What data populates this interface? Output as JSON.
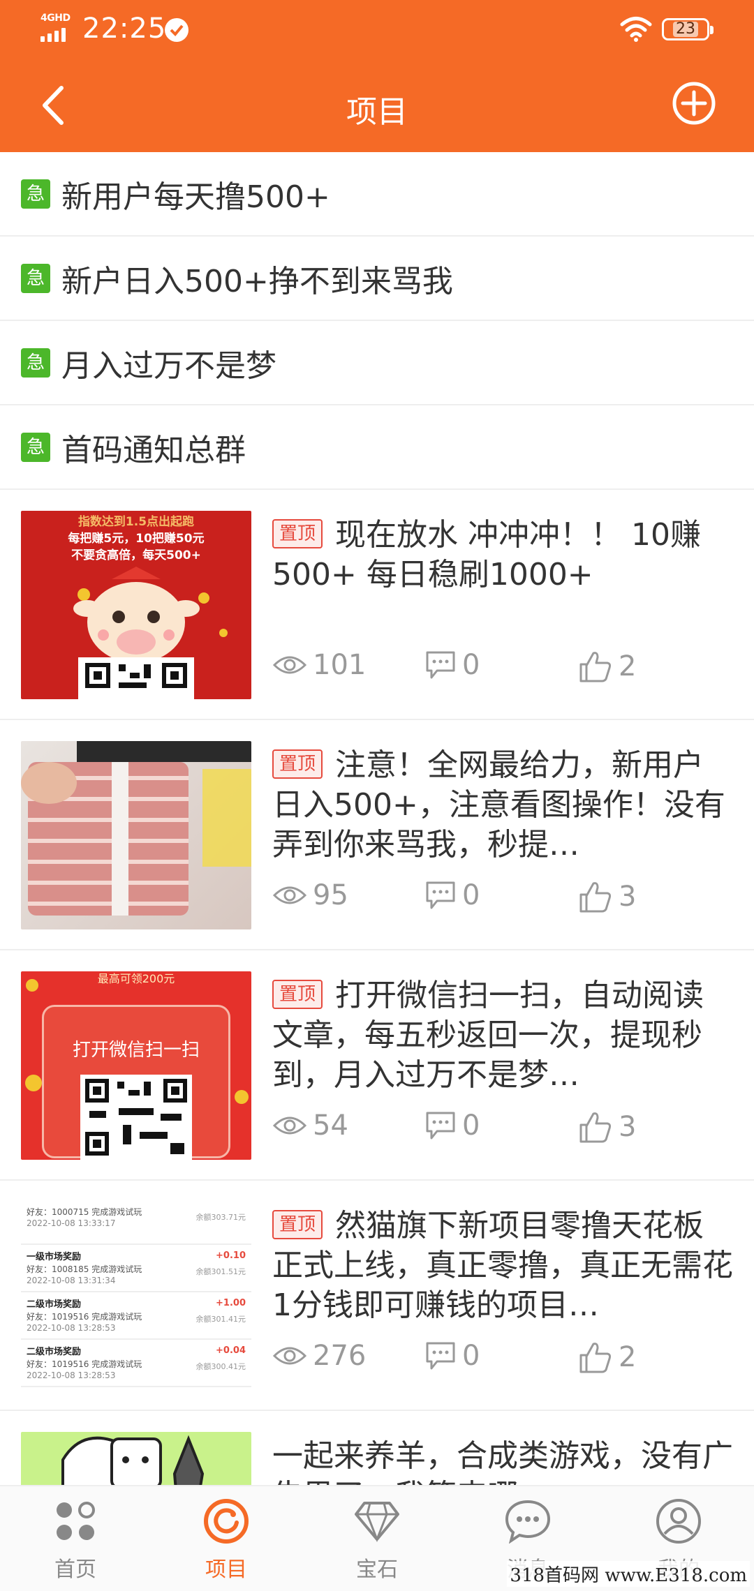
{
  "status_bar": {
    "network": "4GHD",
    "time": "22:25",
    "battery": "23"
  },
  "nav": {
    "title": "项目"
  },
  "notices": [
    {
      "badge": "急",
      "text": "新用户每天撸500+"
    },
    {
      "badge": "急",
      "text": "新户日入500+挣不到来骂我"
    },
    {
      "badge": "急",
      "text": "月入过万不是梦"
    },
    {
      "badge": "急",
      "text": "首码通知总群"
    }
  ],
  "posts": [
    {
      "pin": "置顶",
      "title": "现在放水 冲冲冲！！ 10赚500+ 每日稳刷1000+",
      "views": "101",
      "comments": "0",
      "likes": "2",
      "thumb": {
        "lines": [
          "指数达到1.5点出起跑",
          "每把赚5元，10把赚50元",
          "不要贪高倍，每天500+"
        ]
      }
    },
    {
      "pin": "置顶",
      "title": "注意！全网最给力，新用户日入500+，注意看图操作！没有弄到你来骂我，秒提…",
      "views": "95",
      "comments": "0",
      "likes": "3"
    },
    {
      "pin": "置顶",
      "title": "打开微信扫一扫，自动阅读文章，每五秒返回一次，提现秒到，月入过万不是梦…",
      "views": "54",
      "comments": "0",
      "likes": "3",
      "thumb": {
        "top": "最高可领200元",
        "button": "打开微信扫一扫"
      }
    },
    {
      "pin": "置顶",
      "title": "然猫旗下新项目零撸天花板正式上线，真正零撸，真正无需花1分钱即可赚钱的项目…",
      "views": "276",
      "comments": "0",
      "likes": "2",
      "thumb": {
        "rows": [
          {
            "head": "",
            "friend": "好友：1000715 完成游戏试玩",
            "date": "2022-10-08 13:33:17",
            "amount": "",
            "balance": "余额303.71元"
          },
          {
            "head": "一级市场奖励",
            "friend": "好友：1008185 完成游戏试玩",
            "date": "2022-10-08 13:31:34",
            "amount": "+0.10",
            "balance": "余额301.51元"
          },
          {
            "head": "二级市场奖励",
            "friend": "好友：1019516 完成游戏试玩",
            "date": "2022-10-08 13:28:53",
            "amount": "+1.00",
            "balance": "余额301.41元"
          },
          {
            "head": "二级市场奖励",
            "friend": "好友：1019516 完成游戏试玩",
            "date": "2022-10-08 13:28:53",
            "amount": "+0.04",
            "balance": "余额300.41元"
          }
        ]
      }
    },
    {
      "pin": "",
      "title": "一起来养羊，合成类游戏，没有广告思了，我等来哪",
      "views": "",
      "comments": "",
      "likes": ""
    }
  ],
  "tabs": [
    {
      "label": "首页",
      "icon": "grid-icon"
    },
    {
      "label": "项目",
      "icon": "project-icon"
    },
    {
      "label": "宝石",
      "icon": "diamond-icon"
    },
    {
      "label": "消息",
      "icon": "message-icon"
    },
    {
      "label": "我的",
      "icon": "profile-icon"
    }
  ],
  "watermark": "318首码网 www.E318.com",
  "colors": {
    "brand": "#F56A26",
    "urgent": "#4CB72A",
    "pin": "#E64A3D"
  }
}
